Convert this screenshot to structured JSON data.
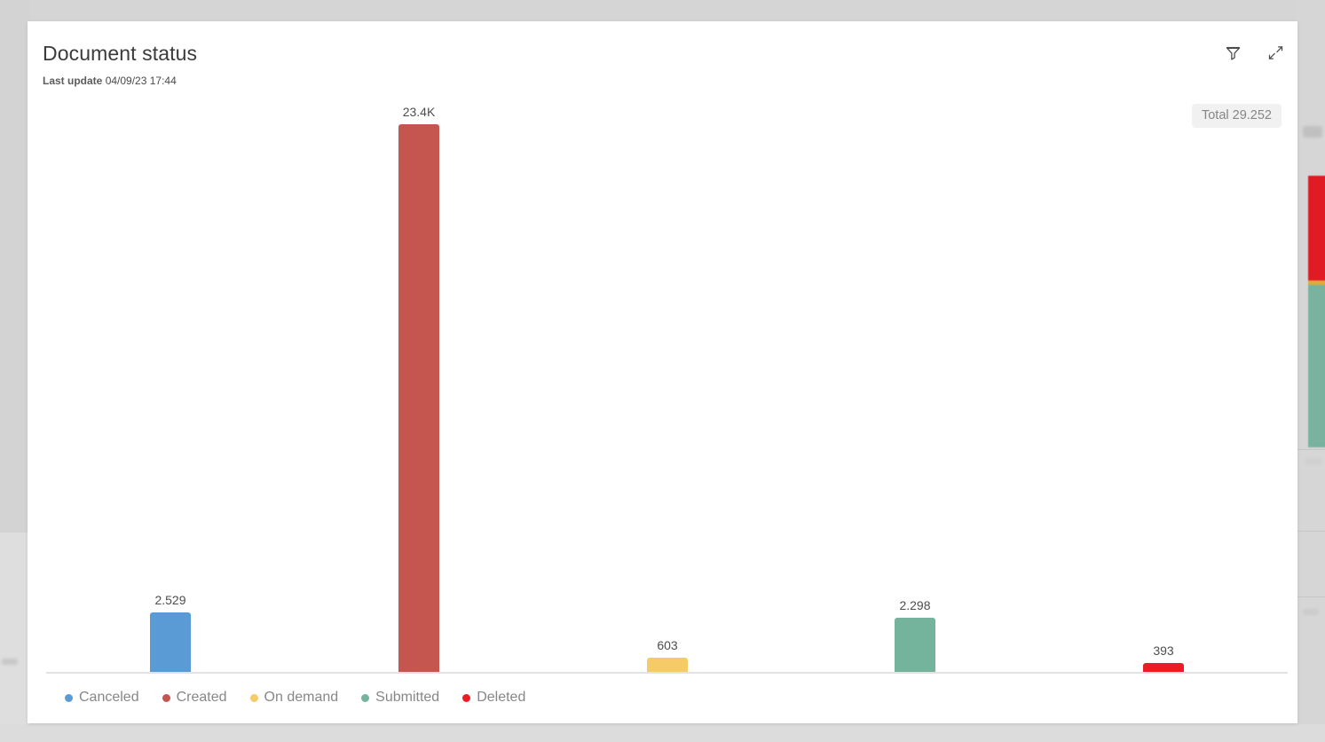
{
  "backdrop": {
    "description": "blurred dashboard behind the focused card"
  },
  "card": {
    "title": "Document status",
    "subtitle_label": "Last update",
    "subtitle_value": "04/09/23 17:44",
    "actions": [
      {
        "name": "filter-icon",
        "tooltip": "Filter"
      },
      {
        "name": "expand-icon",
        "tooltip": "Collapse"
      }
    ],
    "total_badge": "Total 29.252"
  },
  "chart_data": {
    "type": "bar",
    "title": "Document status",
    "xlabel": "",
    "ylabel": "",
    "grid": false,
    "legend_position": "bottom-left",
    "ylim": [
      0,
      23400
    ],
    "categories": [
      "Canceled",
      "Created",
      "On demand",
      "Submitted",
      "Deleted"
    ],
    "values": [
      2529,
      23400,
      603,
      2298,
      393
    ],
    "value_labels": [
      "2.529",
      "23.4K",
      "603",
      "2.298",
      "393"
    ],
    "colors": [
      "#5b9bd5",
      "#c4564f",
      "#f5cb68",
      "#74b49c",
      "#ed1c24"
    ],
    "total": 29252,
    "total_label": "Total 29.252",
    "series": [
      {
        "name": "Document status",
        "values": [
          2529,
          23400,
          603,
          2298,
          393
        ]
      }
    ]
  },
  "legend": {
    "items": [
      {
        "label": "Canceled",
        "color": "#5b9bd5"
      },
      {
        "label": "Created",
        "color": "#c4564f"
      },
      {
        "label": "On demand",
        "color": "#f5cb68"
      },
      {
        "label": "Submitted",
        "color": "#74b49c"
      },
      {
        "label": "Deleted",
        "color": "#ed1c24"
      }
    ]
  }
}
